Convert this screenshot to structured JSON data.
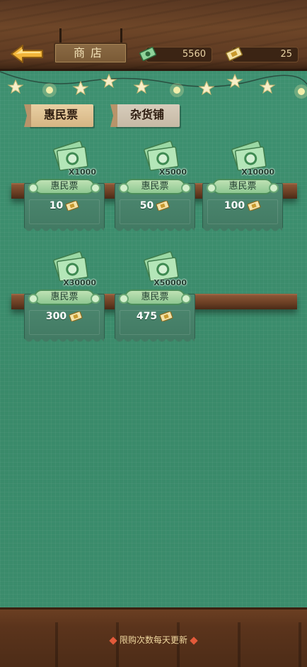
{
  "header": {
    "title": "商店",
    "currency_1": "5560",
    "currency_2": "25"
  },
  "tabs": [
    {
      "label": "惠民票",
      "active": true
    },
    {
      "label": "杂货铺",
      "active": false
    }
  ],
  "items": [
    {
      "name": "惠民票",
      "quantity": "X1000",
      "price": "10"
    },
    {
      "name": "惠民票",
      "quantity": "X5000",
      "price": "50"
    },
    {
      "name": "惠民票",
      "quantity": "X10000",
      "price": "100"
    },
    {
      "name": "惠民票",
      "quantity": "X30000",
      "price": "300"
    },
    {
      "name": "惠民票",
      "quantity": "X50000",
      "price": "475"
    }
  ],
  "footer": {
    "notice": "限购次数每天更新"
  },
  "colors": {
    "background": "#3b8c6c",
    "wood": "#6b3f22",
    "back_arrow": "#f2b53a"
  },
  "icons": [
    "back-arrow-icon",
    "cash-icon",
    "ticket-icon",
    "star-icon",
    "bulb-icon"
  ]
}
